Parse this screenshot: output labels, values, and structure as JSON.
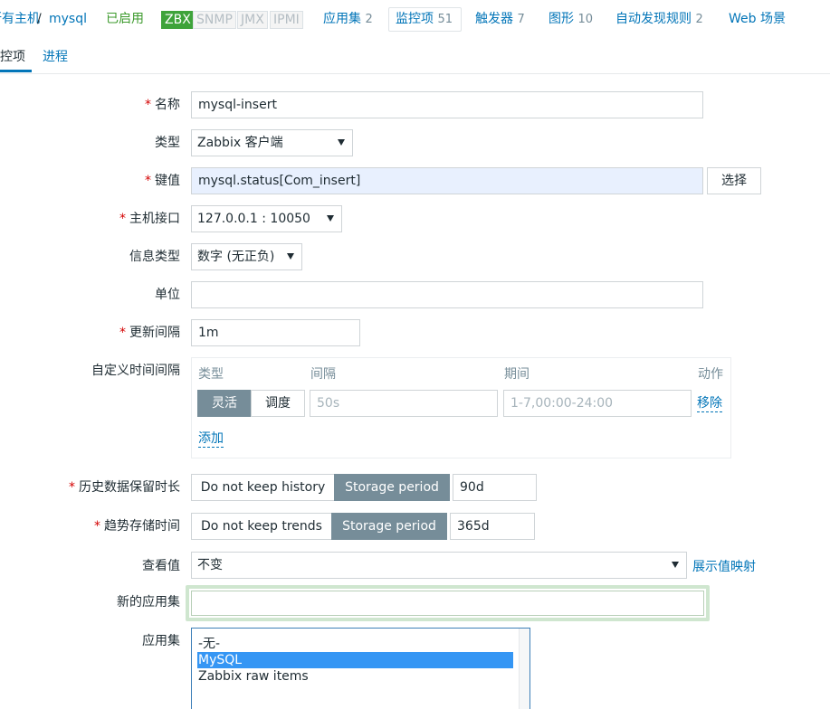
{
  "nav": {
    "crumb_hosts": "所有主机",
    "sep": "/",
    "crumb_host": "mysql",
    "status": "已启用",
    "avail": [
      "ZBX",
      "SNMP",
      "JMX",
      "IPMI"
    ],
    "tabs": [
      {
        "label": "应用集",
        "count": "2"
      },
      {
        "label": "监控项",
        "count": "51"
      },
      {
        "label": "触发器",
        "count": "7"
      },
      {
        "label": "图形",
        "count": "10"
      },
      {
        "label": "自动发现规则",
        "count": "2"
      },
      {
        "label": "Web 场景",
        "count": ""
      }
    ]
  },
  "subtabs": [
    "监控项",
    "进程"
  ],
  "form": {
    "name_label": "名称",
    "name_value": "mysql-insert",
    "type_label": "类型",
    "type_value": "Zabbix 客户端",
    "key_label": "键值",
    "key_value": "mysql.status[Com_insert]",
    "key_select_button": "选择",
    "interface_label": "主机接口",
    "interface_value": "127.0.0.1 : 10050",
    "info_type_label": "信息类型",
    "info_type_value": "数字 (无正负)",
    "units_label": "单位",
    "units_value": "",
    "interval_label": "更新间隔",
    "interval_value": "1m",
    "custom_label": "自定义时间间隔",
    "custom": {
      "col_type": "类型",
      "col_interval": "间隔",
      "col_period": "期间",
      "col_action": "动作",
      "seg_flexible": "灵活",
      "seg_scheduling": "调度",
      "interval_placeholder": "50s",
      "period_placeholder": "1-7,00:00-24:00",
      "remove": "移除",
      "add": "添加"
    },
    "history_label": "历史数据保留时长",
    "history_off": "Do not keep history",
    "history_on": "Storage period",
    "history_value": "90d",
    "trends_label": "趋势存储时间",
    "trends_off": "Do not keep trends",
    "trends_on": "Storage period",
    "trends_value": "365d",
    "valuemap_label": "查看值",
    "valuemap_value": "不变",
    "valuemap_link": "展示值映射",
    "new_app_label": "新的应用集",
    "new_app_value": "",
    "apps_label": "应用集",
    "apps_options": [
      "-无-",
      "MySQL",
      "Zabbix raw items"
    ]
  }
}
